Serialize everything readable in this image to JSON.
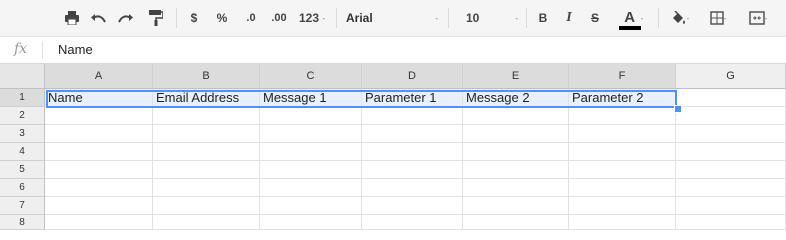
{
  "toolbar": {
    "currency_label": "$",
    "percent_label": "%",
    "decrease_decimals_label": ".0",
    "increase_decimals_label": ".00",
    "more_formats_label": "123",
    "font_name": "Arial",
    "font_size": "10",
    "bold_label": "B",
    "italic_label": "I",
    "strikethrough_label": "S",
    "text_color_label": "A",
    "caret": "-",
    "text_color": "#000000"
  },
  "formula_bar": {
    "fx_label": "fx",
    "value": "Name"
  },
  "columns": [
    "A",
    "B",
    "C",
    "D",
    "E",
    "F",
    "G"
  ],
  "rows": [
    "1",
    "2",
    "3",
    "4",
    "5",
    "6",
    "7",
    "8"
  ],
  "cells_row1": [
    "Name",
    "Email Address",
    "Message 1",
    "Parameter 1",
    "Message 2",
    "Parameter 2",
    ""
  ],
  "colors": {
    "selection": "#4d90fe",
    "selected_row_fill": "#e8f0fe"
  }
}
